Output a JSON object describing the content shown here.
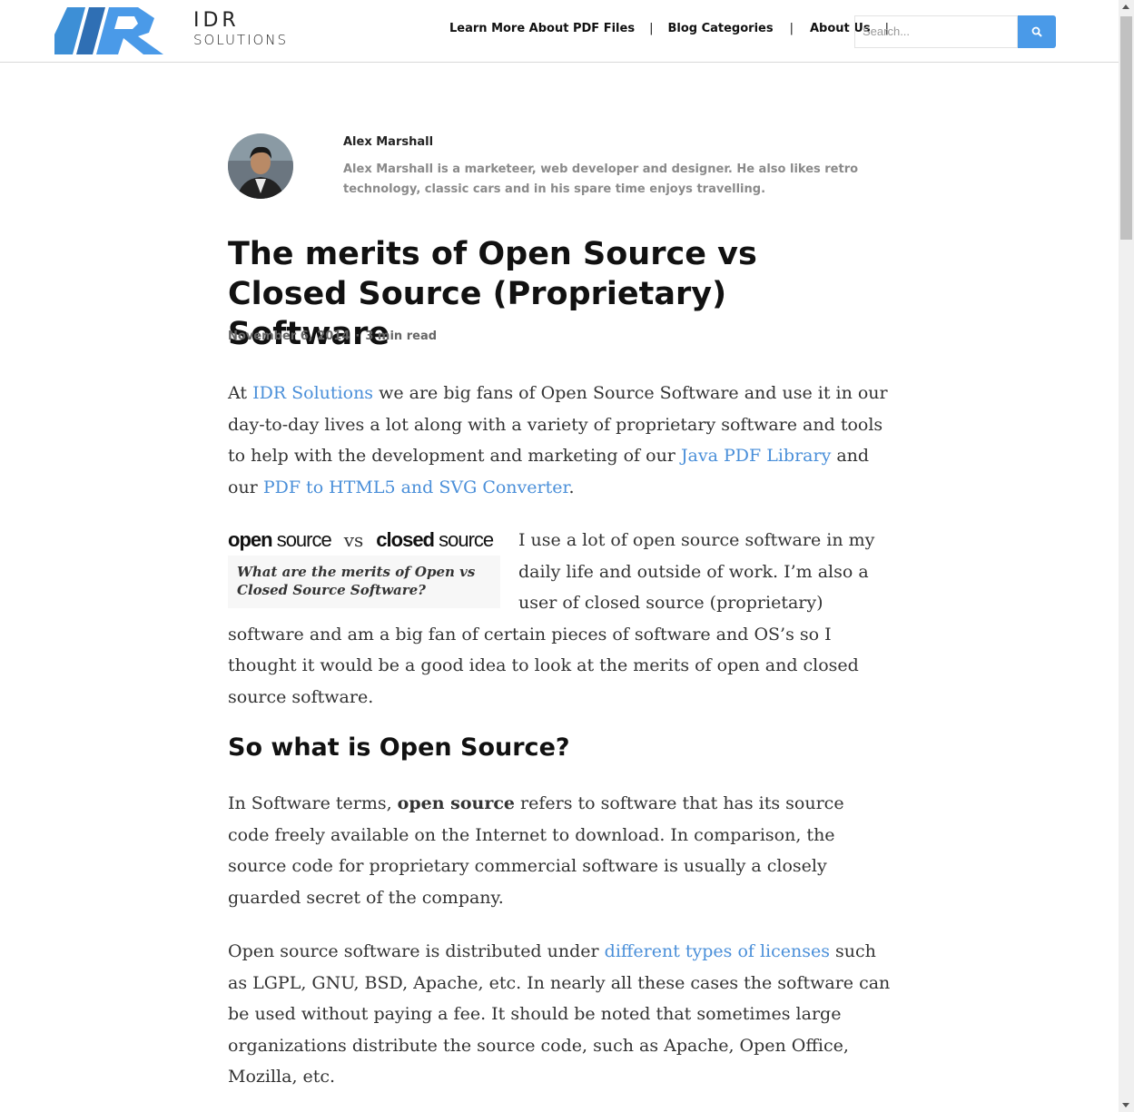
{
  "header": {
    "brand_line1": "IDR",
    "brand_line2": "SOLUTIONS",
    "nav": [
      "Learn More About PDF Files",
      "Blog Categories",
      "About Us"
    ],
    "nav_separator": "|",
    "search_placeholder": "Search...",
    "accent_color": "#4a9ae8"
  },
  "author": {
    "name": "Alex Marshall",
    "bio": "Alex Marshall is a marketeer, web developer and designer. He also likes retro technology, classic cars and in his spare time enjoys travelling."
  },
  "article": {
    "title": "The merits of Open Source vs Closed Source (Proprietary) Software",
    "date": "November 6, 2014",
    "meta_separator": "·",
    "read_time": "3 min read",
    "p1": {
      "t1": "At ",
      "link1": "IDR Solutions",
      "t2": " we are big fans of Open Source Software and use it in our day-to-day lives a lot along with a variety of proprietary software and tools to help with the development and marketing of our ",
      "link2": "Java PDF Library",
      "t3": " and our ",
      "link3": "PDF to HTML5 and SVG Converter",
      "t4": "."
    },
    "figure": {
      "open_a": "open",
      "open_b": "source",
      "vs": "vs",
      "closed_a": "closed",
      "closed_b": "source",
      "caption": "What are the merits of Open vs Closed Source Software?"
    },
    "p2": "I use a lot of open source software in my daily life and outside of work. I’m also a user of closed source (proprietary) software and am a big fan of certain pieces of software and OS’s so I thought it would be a good idea to look at the merits of open and closed source software.",
    "h2": "So what is Open Source?",
    "p3": {
      "t1": "In Software terms, ",
      "bold": "open source",
      "t2": " refers to software that has its source code freely available on the Internet to download. In comparison, the source code for proprietary commercial software is usually a closely guarded secret of the company."
    },
    "p4": {
      "t1": "Open source software is distributed under ",
      "link": "different types of licenses",
      "t2": " such as LGPL, GNU, BSD, Apache, etc. In nearly all these cases the software can be used without paying a fee. It should be noted that sometimes large organizations distribute the source code, such as Apache, Open Office, Mozilla, etc."
    }
  }
}
